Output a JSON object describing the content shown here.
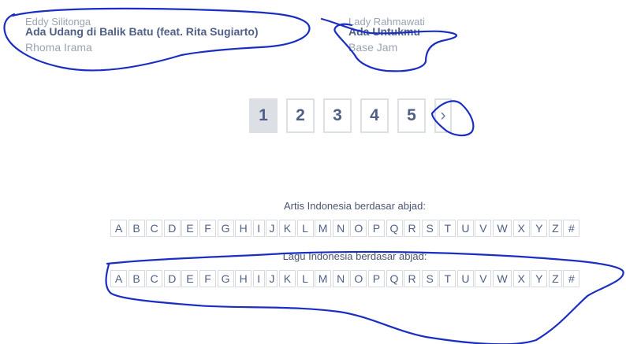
{
  "songs": [
    {
      "prev_text": "Eddy Silitonga",
      "title": "Ada Udang di Balik Batu (feat. Rita Sugiarto)",
      "artist": "Rhoma Irama"
    },
    {
      "prev_text": "Lady Rahmawati",
      "title": "Ada Untukmu",
      "artist": "Base Jam"
    }
  ],
  "pagination": {
    "pages": [
      "1",
      "2",
      "3",
      "4",
      "5"
    ],
    "active_page": "1",
    "next_label": "›"
  },
  "artis_heading": "Artis Indonesia berdasar abjad:",
  "lagu_heading": "Lagu Indonesia berdasar abjad:",
  "letters": [
    "A",
    "B",
    "C",
    "D",
    "E",
    "F",
    "G",
    "H",
    "I",
    "J",
    "K",
    "L",
    "M",
    "N",
    "O",
    "P",
    "Q",
    "R",
    "S",
    "T",
    "U",
    "V",
    "W",
    "X",
    "Y",
    "Z",
    "#"
  ],
  "annotation_color": "#1a2ec2"
}
